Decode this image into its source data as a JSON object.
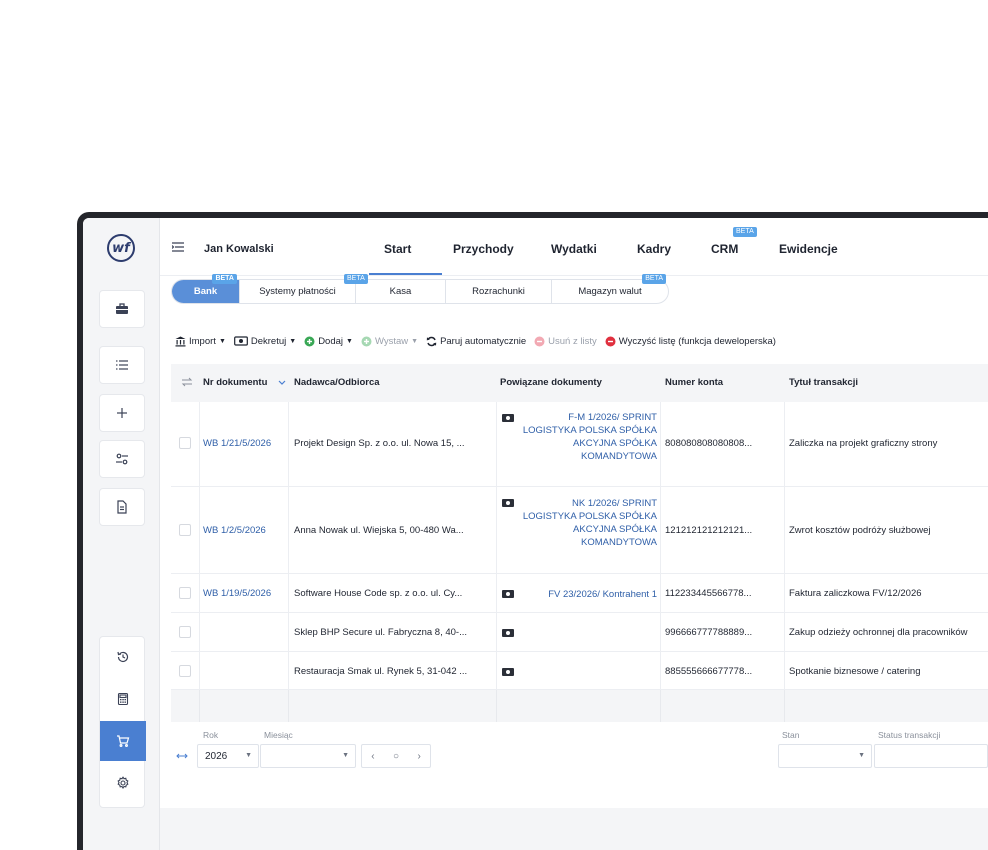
{
  "user": {
    "name": "Jan Kowalski"
  },
  "nav": {
    "tabs": [
      {
        "label": "Start"
      },
      {
        "label": "Przychody"
      },
      {
        "label": "Wydatki"
      },
      {
        "label": "Kadry"
      },
      {
        "label": "CRM",
        "badge": "BETA"
      },
      {
        "label": "Ewidencje"
      }
    ]
  },
  "subtabs": [
    {
      "label": "Bank",
      "badge": "BETA",
      "active": true
    },
    {
      "label": "Systemy płatności",
      "badge": "BETA"
    },
    {
      "label": "Kasa"
    },
    {
      "label": "Rozrachunki"
    },
    {
      "label": "Magazyn walut",
      "badge": "BETA"
    }
  ],
  "toolbar": {
    "import": "Import",
    "dekretuj": "Dekretuj",
    "dodaj": "Dodaj",
    "wystaw": "Wystaw",
    "paruj": "Paruj automatycznie",
    "usun": "Usuń z listy",
    "wyczysc": "Wyczyść listę (funkcja deweloperska)"
  },
  "table": {
    "headers": {
      "nr": "Nr dokumentu",
      "nadawca": "Nadawca/Odbiorca",
      "powiazane": "Powiązane dokumenty",
      "konto": "Numer konta",
      "tytul": "Tytuł transakcji"
    },
    "rows": [
      {
        "nr": "WB 1/21/5/2026",
        "nadawca": "Projekt Design Sp. z o.o. ul. Nowa 15, ...",
        "powiazane": [
          "F-M 1/2026/ SPRINT",
          "LOGISTYKA POLSKA SPÓŁKA",
          "AKCYJNA SPÓŁKA",
          "KOMANDYTOWA"
        ],
        "konto": "808080808080808...",
        "tytul": "Zaliczka na projekt graficzny strony"
      },
      {
        "nr": "WB 1/2/5/2026",
        "nadawca": "Anna Nowak ul. Wiejska 5, 00-480 Wa...",
        "powiazane": [
          "NK 1/2026/ SPRINT",
          "LOGISTYKA POLSKA SPÓŁKA",
          "AKCYJNA SPÓŁKA",
          "KOMANDYTOWA"
        ],
        "konto": "121212121212121...",
        "tytul": "Zwrot kosztów podróży służbowej"
      },
      {
        "nr": "WB 1/19/5/2026",
        "nadawca": "Software House Code sp. z o.o. ul. Cy...",
        "powiazane": [
          "FV 23/2026/ Kontrahent 1"
        ],
        "konto": "112233445566778...",
        "tytul": "Faktura zaliczkowa FV/12/2026"
      },
      {
        "nr": "",
        "nadawca": "Sklep BHP Secure ul. Fabryczna 8, 40-...",
        "powiazane": [],
        "konto": "996666777788889...",
        "tytul": "Zakup odzieży ochronnej dla pracowników"
      },
      {
        "nr": "",
        "nadawca": "Restauracja Smak ul. Rynek 5, 31-042 ...",
        "powiazane": [],
        "konto": "885555666677778...",
        "tytul": "Spotkanie biznesowe / catering"
      }
    ]
  },
  "filters": {
    "rok_label": "Rok",
    "rok_value": "2026",
    "miesiac_label": "Miesiąc",
    "stan_label": "Stan",
    "status_label": "Status transakcji"
  },
  "icons": {
    "logo": "wf",
    "sidebar": [
      "briefcase-icon",
      "list-icon",
      "plus-icon",
      "sliders-icon",
      "document-icon"
    ],
    "sidebar_bottom": [
      "history-icon",
      "calculator-icon",
      "cart-icon",
      "settings-icon"
    ]
  },
  "colors": {
    "accent": "#4a7fd1",
    "link": "#2f5fa8",
    "badge": "#5aa4e8"
  }
}
